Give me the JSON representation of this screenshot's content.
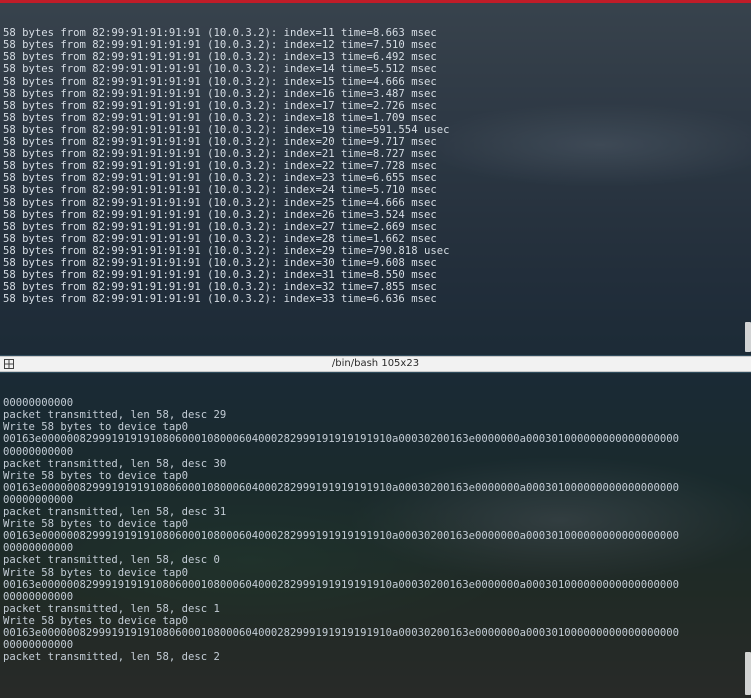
{
  "top_terminal": {
    "lines": [
      "58 bytes from 82:99:91:91:91:91 (10.0.3.2): index=11 time=8.663 msec",
      "58 bytes from 82:99:91:91:91:91 (10.0.3.2): index=12 time=7.510 msec",
      "58 bytes from 82:99:91:91:91:91 (10.0.3.2): index=13 time=6.492 msec",
      "58 bytes from 82:99:91:91:91:91 (10.0.3.2): index=14 time=5.512 msec",
      "58 bytes from 82:99:91:91:91:91 (10.0.3.2): index=15 time=4.666 msec",
      "58 bytes from 82:99:91:91:91:91 (10.0.3.2): index=16 time=3.487 msec",
      "58 bytes from 82:99:91:91:91:91 (10.0.3.2): index=17 time=2.726 msec",
      "58 bytes from 82:99:91:91:91:91 (10.0.3.2): index=18 time=1.709 msec",
      "58 bytes from 82:99:91:91:91:91 (10.0.3.2): index=19 time=591.554 usec",
      "58 bytes from 82:99:91:91:91:91 (10.0.3.2): index=20 time=9.717 msec",
      "58 bytes from 82:99:91:91:91:91 (10.0.3.2): index=21 time=8.727 msec",
      "58 bytes from 82:99:91:91:91:91 (10.0.3.2): index=22 time=7.728 msec",
      "58 bytes from 82:99:91:91:91:91 (10.0.3.2): index=23 time=6.655 msec",
      "58 bytes from 82:99:91:91:91:91 (10.0.3.2): index=24 time=5.710 msec",
      "58 bytes from 82:99:91:91:91:91 (10.0.3.2): index=25 time=4.666 msec",
      "58 bytes from 82:99:91:91:91:91 (10.0.3.2): index=26 time=3.524 msec",
      "58 bytes from 82:99:91:91:91:91 (10.0.3.2): index=27 time=2.669 msec",
      "58 bytes from 82:99:91:91:91:91 (10.0.3.2): index=28 time=1.662 msec",
      "58 bytes from 82:99:91:91:91:91 (10.0.3.2): index=29 time=790.818 usec",
      "58 bytes from 82:99:91:91:91:91 (10.0.3.2): index=30 time=9.608 msec",
      "58 bytes from 82:99:91:91:91:91 (10.0.3.2): index=31 time=8.550 msec",
      "58 bytes from 82:99:91:91:91:91 (10.0.3.2): index=32 time=7.855 msec",
      "58 bytes from 82:99:91:91:91:91 (10.0.3.2): index=33 time=6.636 msec"
    ]
  },
  "bottom_terminal": {
    "title": "/bin/bash 105x23",
    "lines": [
      "00000000000",
      "packet transmitted, len 58, desc 29",
      "Write 58 bytes to device tap0",
      "00163e0000008299919191910806000108000604000282999191919191910a00030200163e0000000a000301000000000000000000",
      "00000000000",
      "packet transmitted, len 58, desc 30",
      "Write 58 bytes to device tap0",
      "00163e0000008299919191910806000108000604000282999191919191910a00030200163e0000000a000301000000000000000000",
      "00000000000",
      "packet transmitted, len 58, desc 31",
      "Write 58 bytes to device tap0",
      "00163e0000008299919191910806000108000604000282999191919191910a00030200163e0000000a000301000000000000000000",
      "00000000000",
      "packet transmitted, len 58, desc 0",
      "Write 58 bytes to device tap0",
      "00163e0000008299919191910806000108000604000282999191919191910a00030200163e0000000a000301000000000000000000",
      "00000000000",
      "packet transmitted, len 58, desc 1",
      "Write 58 bytes to device tap0",
      "00163e0000008299919191910806000108000604000282999191919191910a00030200163e0000000a000301000000000000000000",
      "00000000000",
      "packet transmitted, len 58, desc 2"
    ]
  },
  "icons": {
    "titlebar": "terminal-grid-icon"
  },
  "colors": {
    "accent": "#c01c28",
    "titlebar": "#f2f2f2",
    "text": "#d6dde4"
  }
}
